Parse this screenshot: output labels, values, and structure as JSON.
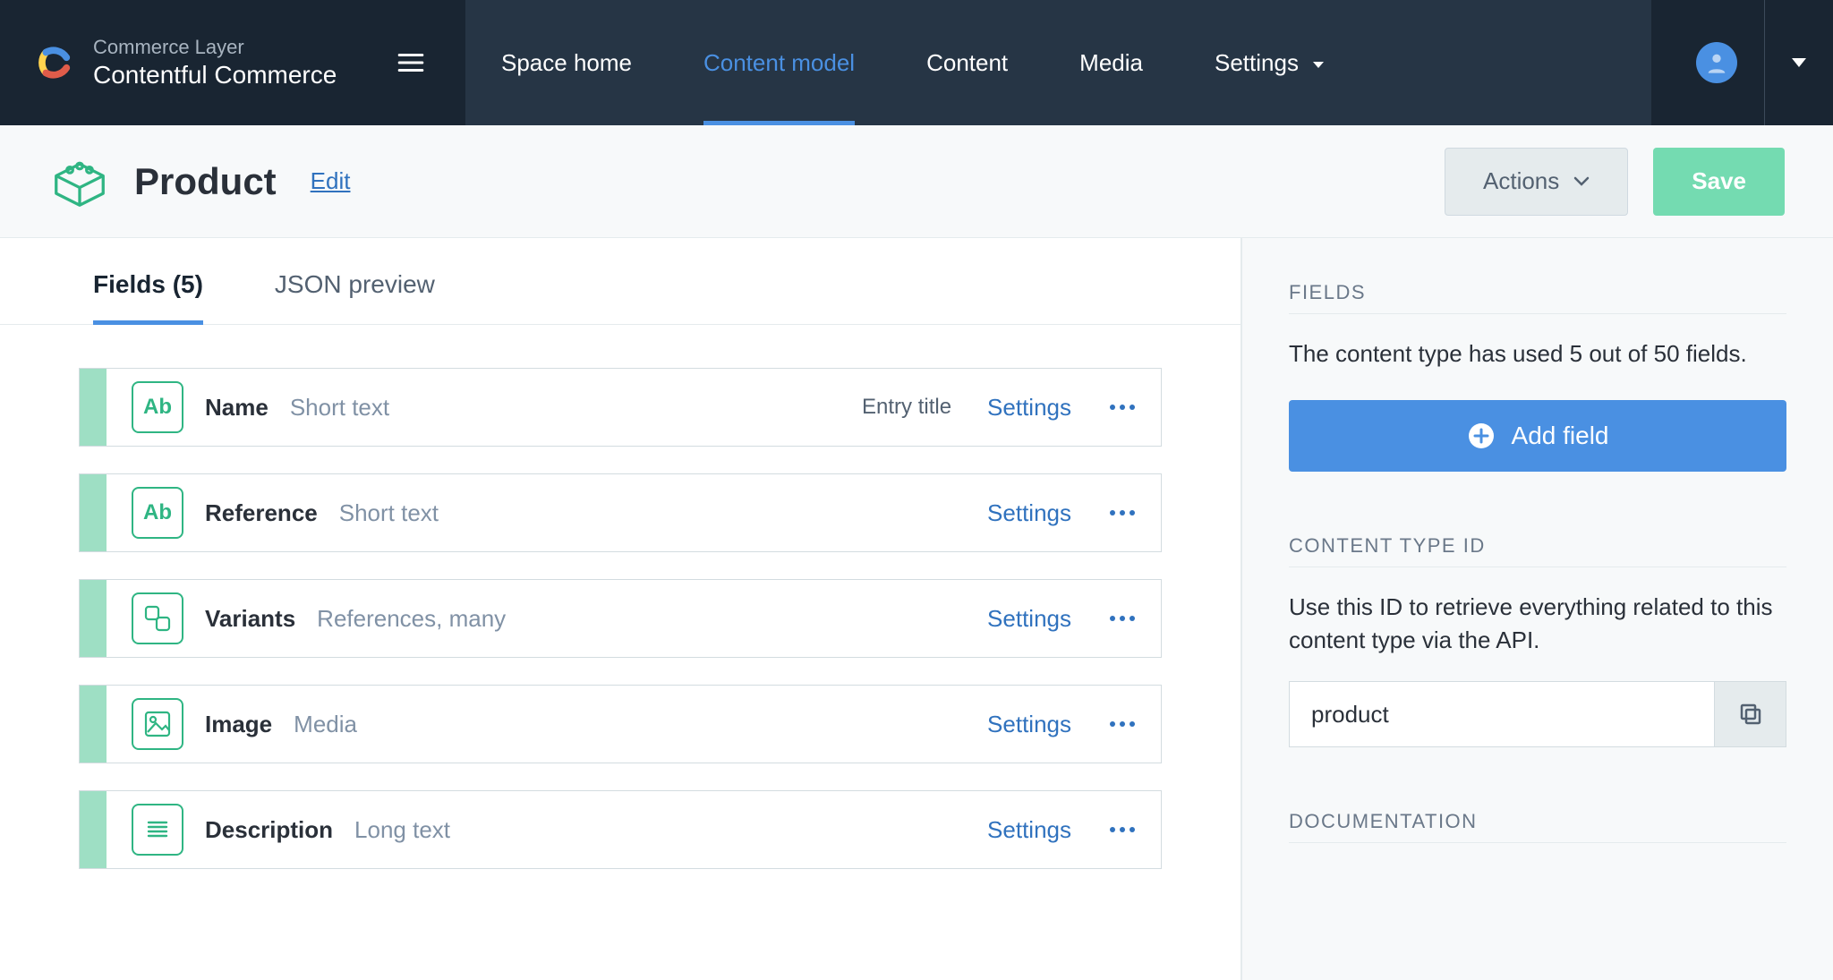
{
  "brand": {
    "super": "Commerce Layer",
    "name": "Contentful Commerce"
  },
  "nav": {
    "items": [
      {
        "label": "Space home",
        "active": false
      },
      {
        "label": "Content model",
        "active": true
      },
      {
        "label": "Content",
        "active": false
      },
      {
        "label": "Media",
        "active": false
      },
      {
        "label": "Settings",
        "active": false,
        "dropdown": true
      }
    ]
  },
  "subheader": {
    "title": "Product",
    "edit": "Edit",
    "actions": "Actions",
    "save": "Save"
  },
  "tabs": {
    "fields": "Fields (5)",
    "json": "JSON preview"
  },
  "fields": [
    {
      "name": "Name",
      "type": "Short text",
      "tag": "Entry title",
      "icon": "text",
      "settings": "Settings"
    },
    {
      "name": "Reference",
      "type": "Short text",
      "tag": "",
      "icon": "text",
      "settings": "Settings"
    },
    {
      "name": "Variants",
      "type": "References, many",
      "tag": "",
      "icon": "ref",
      "settings": "Settings"
    },
    {
      "name": "Image",
      "type": "Media",
      "tag": "",
      "icon": "media",
      "settings": "Settings"
    },
    {
      "name": "Description",
      "type": "Long text",
      "tag": "",
      "icon": "long",
      "settings": "Settings"
    }
  ],
  "sidebar": {
    "fields_label": "FIELDS",
    "fields_desc": "The content type has used 5 out of 50 fields.",
    "add_field": "Add field",
    "ctid_label": "CONTENT TYPE ID",
    "ctid_desc": "Use this ID to retrieve everything related to this content type via the API.",
    "ctid_value": "product",
    "doc_label": "DOCUMENTATION"
  },
  "colors": {
    "accent": "#4a90e2",
    "green": "#2fb583",
    "save": "#74dbb1",
    "navdark": "#192532",
    "navmid": "#263545"
  }
}
